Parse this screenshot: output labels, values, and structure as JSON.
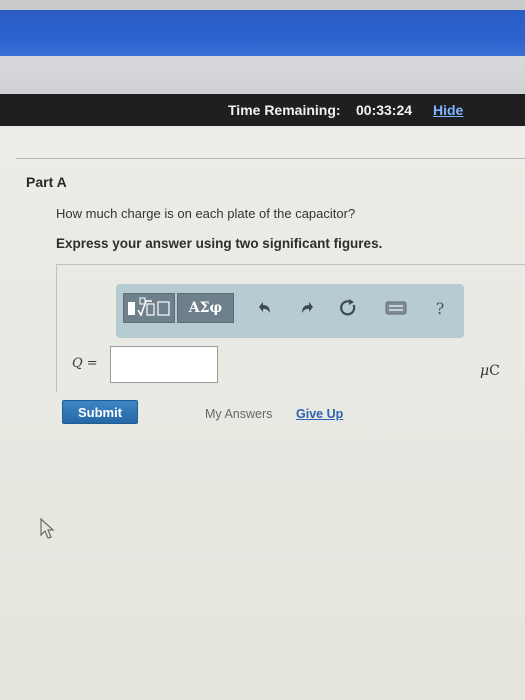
{
  "timer": {
    "label": "Time Remaining:",
    "value": "00:33:24",
    "hide_label": "Hide"
  },
  "part": {
    "title": "Part A",
    "question": "How much charge is on each plate of the capacitor?",
    "instruction": "Express your answer using two significant figures."
  },
  "toolbar": {
    "greek_label": "ΑΣφ",
    "help_label": "?",
    "icons": [
      "template-icon",
      "greek-symbols",
      "undo-icon",
      "redo-icon",
      "reset-icon",
      "keyboard-icon",
      "help-icon"
    ]
  },
  "answer": {
    "variable_label": "Q =",
    "value": "",
    "unit_prefix": "μ",
    "unit_symbol": "C"
  },
  "actions": {
    "submit_label": "Submit",
    "my_answers_label": "My Answers",
    "give_up_label": "Give Up"
  },
  "colors": {
    "header_blue": "#2c63cf",
    "timer_bar": "#1f1f21",
    "hide_link": "#7fb4ff",
    "toolbar_bg": "#b7cbd3",
    "toolbar_button": "#6f808d",
    "submit_button": "#2d72b3",
    "give_up_link": "#2c63b0"
  }
}
